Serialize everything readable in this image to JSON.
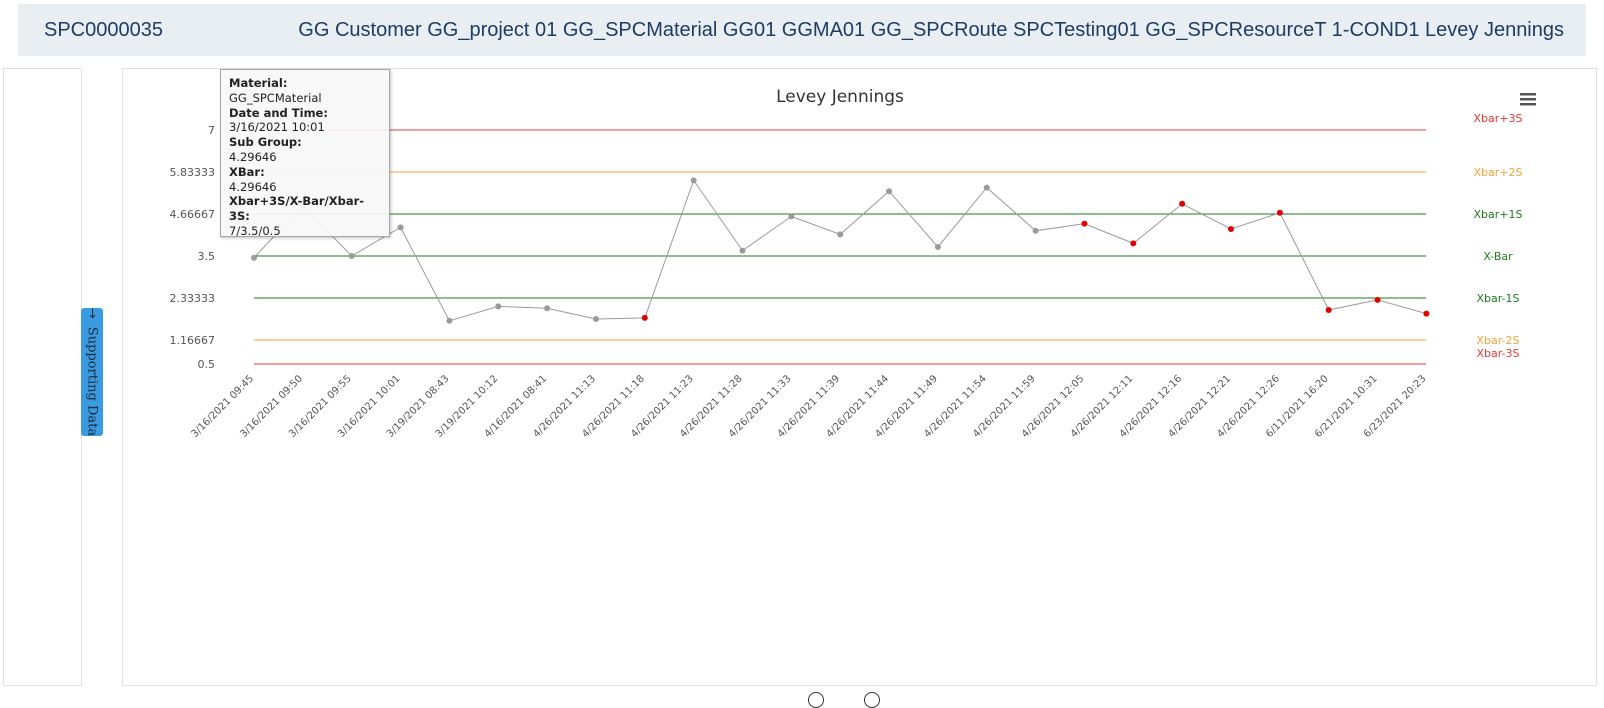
{
  "header": {
    "id": "SPC0000035",
    "description": "GG Customer GG_project 01 GG_SPCMaterial GG01 GGMA01 GG_SPCRoute SPCTesting01 GG_SPCResourceT 1-COND1 Levey Jennings"
  },
  "side_tab": {
    "label": "Supporting Data",
    "icon": "arrow-right-icon"
  },
  "menu_icon": "hamburger-menu-icon",
  "tooltip": {
    "material_label": "Material:",
    "material_value": "GG_SPCMaterial",
    "datetime_label": "Date and Time:",
    "datetime_value": "3/16/2021 10:01",
    "subgroup_label": "Sub Group:",
    "subgroup_value": "4.29646",
    "xbar_label": "XBar:",
    "xbar_value": "4.29646",
    "limits_label": "Xbar+3S/X-Bar/Xbar-3S:",
    "limits_value": "7/3.5/0.5"
  },
  "colors": {
    "sigma3": "#e8373a",
    "sigma2": "#f2a23a",
    "sigma1": "#1e7b1e",
    "center": "#1e7b1e",
    "series": "#9a9a9a",
    "outlier": "#e00000"
  },
  "chart_data": {
    "type": "line",
    "title": "Levey Jennings",
    "x": [
      "3/16/2021 09:45",
      "3/16/2021 09:50",
      "3/16/2021 09:55",
      "3/16/2021 10:01",
      "3/19/2021 08:43",
      "3/19/2021 10:12",
      "4/16/2021 08:41",
      "4/26/2021 11:13",
      "4/26/2021 11:18",
      "4/26/2021 11:23",
      "4/26/2021 11:28",
      "4/26/2021 11:33",
      "4/26/2021 11:39",
      "4/26/2021 11:44",
      "4/26/2021 11:49",
      "4/26/2021 11:54",
      "4/26/2021 11:59",
      "4/26/2021 12:05",
      "4/26/2021 12:11",
      "4/26/2021 12:16",
      "4/26/2021 12:21",
      "4/26/2021 12:26",
      "6/11/2021 16:20",
      "6/21/2021 10:31",
      "6/23/2021 20:23"
    ],
    "series": [
      {
        "values": [
          3.45,
          4.9,
          3.5,
          4.29646,
          1.7,
          2.1,
          2.05,
          1.75,
          1.78,
          5.6,
          3.65,
          4.6,
          4.1,
          5.3,
          3.75,
          5.4,
          4.2,
          4.4,
          3.85,
          4.95,
          4.25,
          4.7,
          2.0,
          2.28,
          1.9
        ],
        "outliers": [
          false,
          false,
          false,
          false,
          false,
          false,
          false,
          false,
          true,
          false,
          false,
          false,
          false,
          false,
          false,
          false,
          false,
          true,
          true,
          true,
          true,
          true,
          true,
          true,
          true
        ]
      }
    ],
    "yticks": [
      "7",
      "5.83333",
      "4.66667",
      "3.5",
      "2.33333",
      "1.16667",
      "0.5"
    ],
    "ylim": [
      0.5,
      7
    ],
    "control_lines": [
      {
        "label": "Xbar+3S",
        "value": 7,
        "level": "sigma3"
      },
      {
        "label": "Xbar+2S",
        "value": 5.83333,
        "level": "sigma2"
      },
      {
        "label": "Xbar+1S",
        "value": 4.66667,
        "level": "sigma1"
      },
      {
        "label": "X-Bar",
        "value": 3.5,
        "level": "center"
      },
      {
        "label": "Xbar-1S",
        "value": 2.33333,
        "level": "sigma1"
      },
      {
        "label": "Xbar-2S",
        "value": 1.16667,
        "level": "sigma2"
      },
      {
        "label": "Xbar-3S",
        "value": 0.5,
        "level": "sigma3"
      }
    ],
    "grid": false,
    "legend": "none"
  }
}
